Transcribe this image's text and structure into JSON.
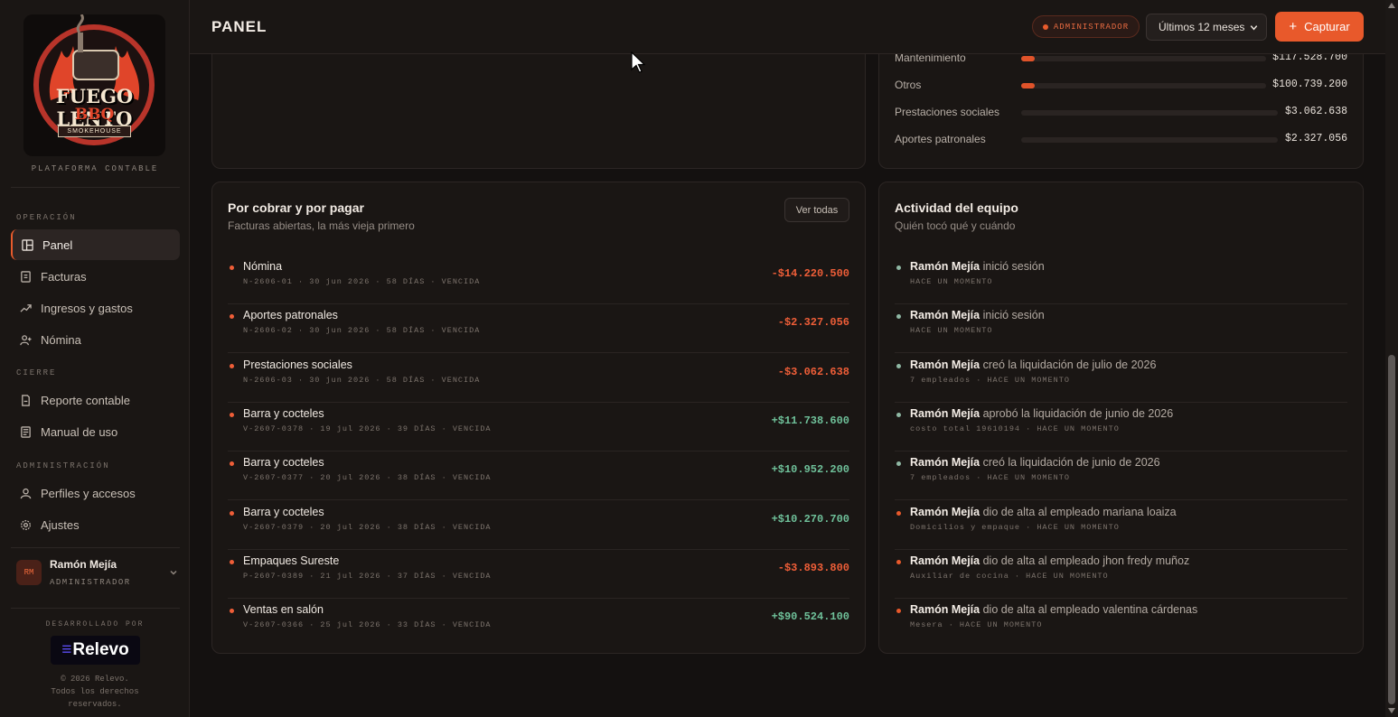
{
  "sidebar": {
    "platform": "PLATAFORMA CONTABLE",
    "logo": {
      "line1": "FUEGO LENTO",
      "line2": "BBQ",
      "line3": "SMOKEHOUSE"
    },
    "sections": [
      {
        "label": "OPERACIÓN",
        "items": [
          {
            "label": "Panel",
            "icon": "dashboard-icon",
            "active": true
          },
          {
            "label": "Facturas",
            "icon": "receipt-icon"
          },
          {
            "label": "Ingresos y gastos",
            "icon": "trend-icon"
          },
          {
            "label": "Nómina",
            "icon": "user-plus-icon"
          }
        ]
      },
      {
        "label": "CIERRE",
        "items": [
          {
            "label": "Reporte contable",
            "icon": "file-icon"
          },
          {
            "label": "Manual de uso",
            "icon": "book-icon"
          }
        ]
      },
      {
        "label": "ADMINISTRACIÓN",
        "items": [
          {
            "label": "Perfiles y accesos",
            "icon": "user-icon"
          },
          {
            "label": "Ajustes",
            "icon": "gear-icon"
          }
        ]
      }
    ],
    "user": {
      "initials": "RM",
      "name": "Ramón Mejía",
      "role": "ADMINISTRADOR"
    },
    "developed_by": "DESARROLLADO POR",
    "dev_logo": "Relevo",
    "copyright_lines": [
      "© 2026 Relevo.",
      "Todos los derechos",
      "reservados."
    ]
  },
  "header": {
    "title": "PANEL",
    "role_badge": "ADMINISTRADOR",
    "period": "Últimos 12 meses",
    "capture_label": "Capturar"
  },
  "expenses": [
    {
      "label": "Mantenimiento",
      "value": "$117.528.700",
      "share": 0.012
    },
    {
      "label": "Otros",
      "value": "$100.739.200",
      "share": 0.011
    },
    {
      "label": "Prestaciones sociales",
      "value": "$3.062.638",
      "share": 0
    },
    {
      "label": "Aportes patronales",
      "value": "$2.327.056",
      "share": 0
    }
  ],
  "receivables": {
    "title": "Por cobrar y por pagar",
    "subtitle": "Facturas abiertas, la más vieja primero",
    "see_all": "Ver todas",
    "rows": [
      {
        "title": "Nómina",
        "meta": "N-2606-01 · 30 jun 2026 · 58 DÍAS · VENCIDA",
        "amount": "-$14.220.500",
        "sign": "neg"
      },
      {
        "title": "Aportes patronales",
        "meta": "N-2606-02 · 30 jun 2026 · 58 DÍAS · VENCIDA",
        "amount": "-$2.327.056",
        "sign": "neg"
      },
      {
        "title": "Prestaciones sociales",
        "meta": "N-2606-03 · 30 jun 2026 · 58 DÍAS · VENCIDA",
        "amount": "-$3.062.638",
        "sign": "neg"
      },
      {
        "title": "Barra y cocteles",
        "meta": "V-2607-0378 · 19 jul 2026 · 39 DÍAS · VENCIDA",
        "amount": "+$11.738.600",
        "sign": "pos"
      },
      {
        "title": "Barra y cocteles",
        "meta": "V-2607-0377 · 20 jul 2026 · 38 DÍAS · VENCIDA",
        "amount": "+$10.952.200",
        "sign": "pos"
      },
      {
        "title": "Barra y cocteles",
        "meta": "V-2607-0379 · 20 jul 2026 · 38 DÍAS · VENCIDA",
        "amount": "+$10.270.700",
        "sign": "pos"
      },
      {
        "title": "Empaques Sureste",
        "meta": "P-2607-0389 · 21 jul 2026 · 37 DÍAS · VENCIDA",
        "amount": "-$3.893.800",
        "sign": "neg"
      },
      {
        "title": "Ventas en salón",
        "meta": "V-2607-0366 · 25 jul 2026 · 33 DÍAS · VENCIDA",
        "amount": "+$90.524.100",
        "sign": "pos"
      }
    ]
  },
  "activity": {
    "title": "Actividad del equipo",
    "subtitle": "Quién tocó qué y cuándo",
    "rows": [
      {
        "who": "Ramón Mejía",
        "what": "inició sesión",
        "meta": "HACE UN MOMENTO",
        "color": "#8fb8a4"
      },
      {
        "who": "Ramón Mejía",
        "what": "inició sesión",
        "meta": "HACE UN MOMENTO",
        "color": "#8fb8a4"
      },
      {
        "who": "Ramón Mejía",
        "what": "creó la liquidación de julio de 2026",
        "meta": "7 empleados · HACE UN MOMENTO",
        "color": "#8fb8a4"
      },
      {
        "who": "Ramón Mejía",
        "what": "aprobó la liquidación de junio de 2026",
        "meta": "costo total 19610194 · HACE UN MOMENTO",
        "color": "#8fb8a4"
      },
      {
        "who": "Ramón Mejía",
        "what": "creó la liquidación de junio de 2026",
        "meta": "7 empleados · HACE UN MOMENTO",
        "color": "#8fb8a4"
      },
      {
        "who": "Ramón Mejía",
        "what": "dio de alta al empleado mariana loaiza",
        "meta": "Domicilios y empaque · HACE UN MOMENTO",
        "color": "#e8592b"
      },
      {
        "who": "Ramón Mejía",
        "what": "dio de alta al empleado jhon fredy muñoz",
        "meta": "Auxiliar de cocina · HACE UN MOMENTO",
        "color": "#e8592b"
      },
      {
        "who": "Ramón Mejía",
        "what": "dio de alta al empleado valentina cárdenas",
        "meta": "Mesera · HACE UN MOMENTO",
        "color": "#e8592b"
      }
    ]
  },
  "colors": {
    "accent": "#e8592b",
    "negative": "#ef5e38",
    "positive": "#6fc19a"
  }
}
